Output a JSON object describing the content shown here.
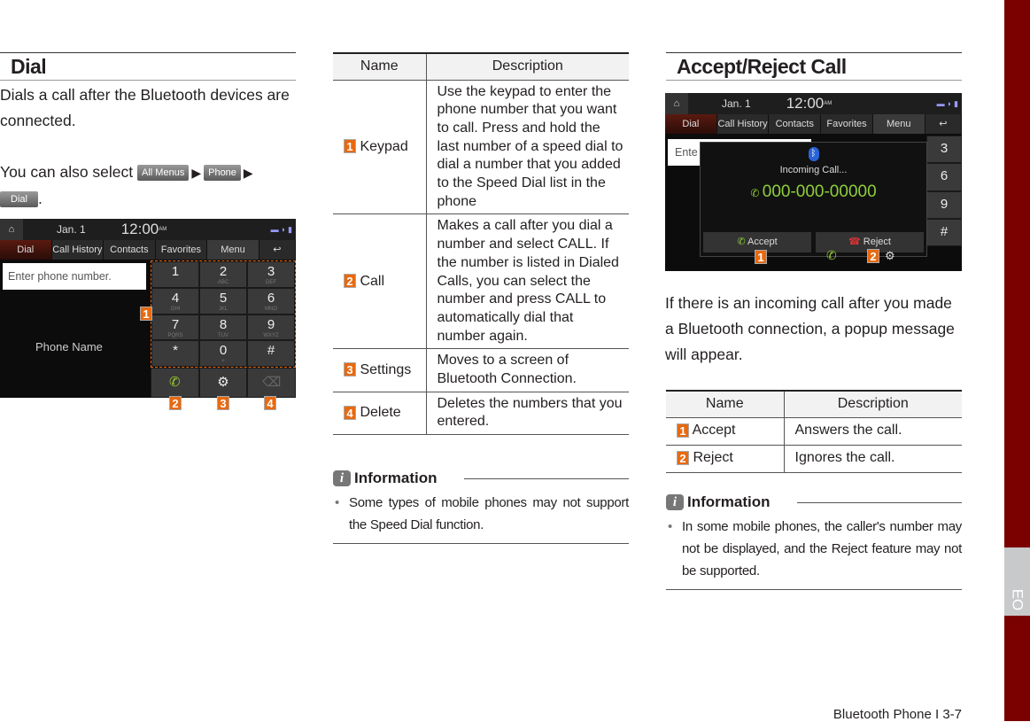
{
  "dial": {
    "title": "Dial",
    "intro": "Dials a call after the Bluetooth devices are connected.",
    "also": "You can also select",
    "chips": [
      "All Menus",
      "Phone",
      "Dial"
    ],
    "screen": {
      "date": "Jan.  1",
      "time": "12:00",
      "ampm": "AM",
      "tabs": [
        "Dial",
        "Call History",
        "Contacts",
        "Favorites",
        "Menu"
      ],
      "input_placeholder": "Enter phone number.",
      "phone_name": "Phone Name",
      "keys": [
        "1",
        "2",
        "3",
        "4",
        "5",
        "6",
        "7",
        "8",
        "9",
        "*",
        "0",
        "#"
      ],
      "subs": [
        "",
        "ABC",
        "DEF",
        "GHI",
        "JKL",
        "MNO",
        "PQRS",
        "TUV",
        "WXYZ",
        "",
        "+",
        ""
      ]
    },
    "callouts": [
      "1",
      "2",
      "3",
      "4"
    ]
  },
  "table1": {
    "headers": [
      "Name",
      "Description"
    ],
    "rows": [
      {
        "num": "1",
        "name": "Keypad",
        "desc": "Use the keypad to enter the phone number that you want to call. Press and hold the last number of a speed dial to dial a number that you added to the Speed Dial list in the phone"
      },
      {
        "num": "2",
        "name": "Call",
        "desc": "Makes a call after you dial a number and select CALL. If the number is listed in Dialed Calls, you can select the number and press CALL to automatically dial that number again."
      },
      {
        "num": "3",
        "name": "Settings",
        "desc": "Moves to a screen of Bluetooth Connection."
      },
      {
        "num": "4",
        "name": "Delete",
        "desc": "Deletes the numbers that you entered."
      }
    ]
  },
  "info1": {
    "title": "Information",
    "text": "Some types of mobile phones may not support the Speed Dial function."
  },
  "accept": {
    "title": "Accept/Reject Call",
    "screen": {
      "incoming": "Incoming Call...",
      "number": "000-000-00000",
      "accept": "Accept",
      "reject": "Reject",
      "input_partial": "Ente"
    },
    "text": "If there is an incoming call after you made a Bluetooth connection, a popup message will appear."
  },
  "table2": {
    "headers": [
      "Name",
      "Description"
    ],
    "rows": [
      {
        "num": "1",
        "name": "Accept",
        "desc": "Answers the call."
      },
      {
        "num": "2",
        "name": "Reject",
        "desc": "Ignores the call."
      }
    ]
  },
  "info2": {
    "title": "Information",
    "text": "In some mobile phones, the caller's number may not be displayed, and the Reject feature may not be supported."
  },
  "footer": "Bluetooth Phone I 3-7",
  "side_tab": "EO",
  "colors": {
    "accent": "#e8690f",
    "side": "#7b0000",
    "green": "#8fcf3a"
  }
}
